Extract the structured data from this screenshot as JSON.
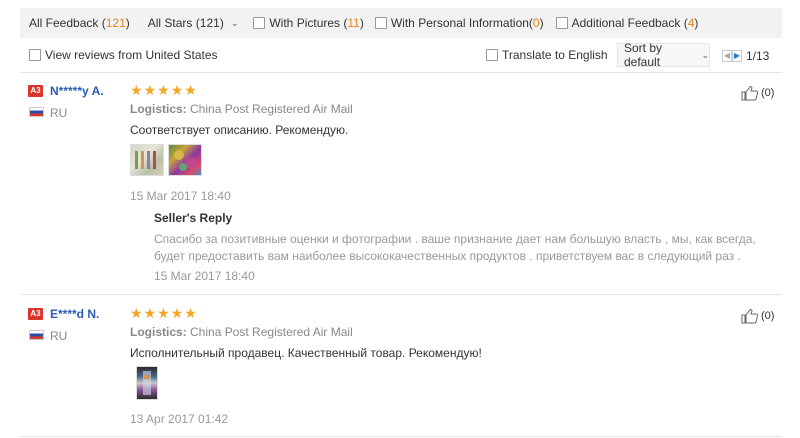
{
  "filters": {
    "all_feedback_label": "All Feedback",
    "all_feedback_count": "121",
    "all_stars_label": "All Stars",
    "all_stars_count": "121",
    "with_pictures_label": "With Pictures",
    "with_pictures_count": "11",
    "personal_info_label": "With Personal Information",
    "personal_info_count": "0",
    "additional_label": "Additional Feedback",
    "additional_count": "4",
    "view_us_label": "View reviews from United States",
    "translate_label": "Translate to English",
    "sort_label": "Sort by default",
    "page_indicator": "1/13"
  },
  "reviews": [
    {
      "badge": "A3",
      "name": "N*****y A.",
      "country": "RU",
      "logistics_label": "Logistics:",
      "logistics_value": "China Post Registered Air Mail",
      "text": "Соответствует описанию. Рекомендую.",
      "date": "15 Mar 2017 18:40",
      "likes": "(0)",
      "stars": 5,
      "reply": {
        "title": "Seller's Reply",
        "text": "Спасибо за позитивные оценки и фотографии . ваше признание дает нам большую власть , мы, как всегда, будет предоставить вам наиболее высококачественных продуктов . приветствуем вас в следующий раз .",
        "date": "15 Mar 2017 18:40"
      }
    },
    {
      "badge": "A3",
      "name": "E****d N.",
      "country": "RU",
      "logistics_label": "Logistics:",
      "logistics_value": "China Post Registered Air Mail",
      "text": "Исполнительный продавец. Качественный товар. Рекомендую!",
      "date": "13 Apr 2017 01:42",
      "likes": "(0)",
      "stars": 5
    }
  ],
  "colors": {
    "accent_count": "#e5861a",
    "name_link": "#2a5bb5",
    "star": "#f5a623",
    "badge": "#d9352a"
  },
  "icons": [
    "checkbox-icon",
    "chevron-down-icon",
    "star-icon",
    "thumbs-up-icon",
    "flag-ru-icon",
    "prev-page-icon",
    "next-page-icon"
  ]
}
